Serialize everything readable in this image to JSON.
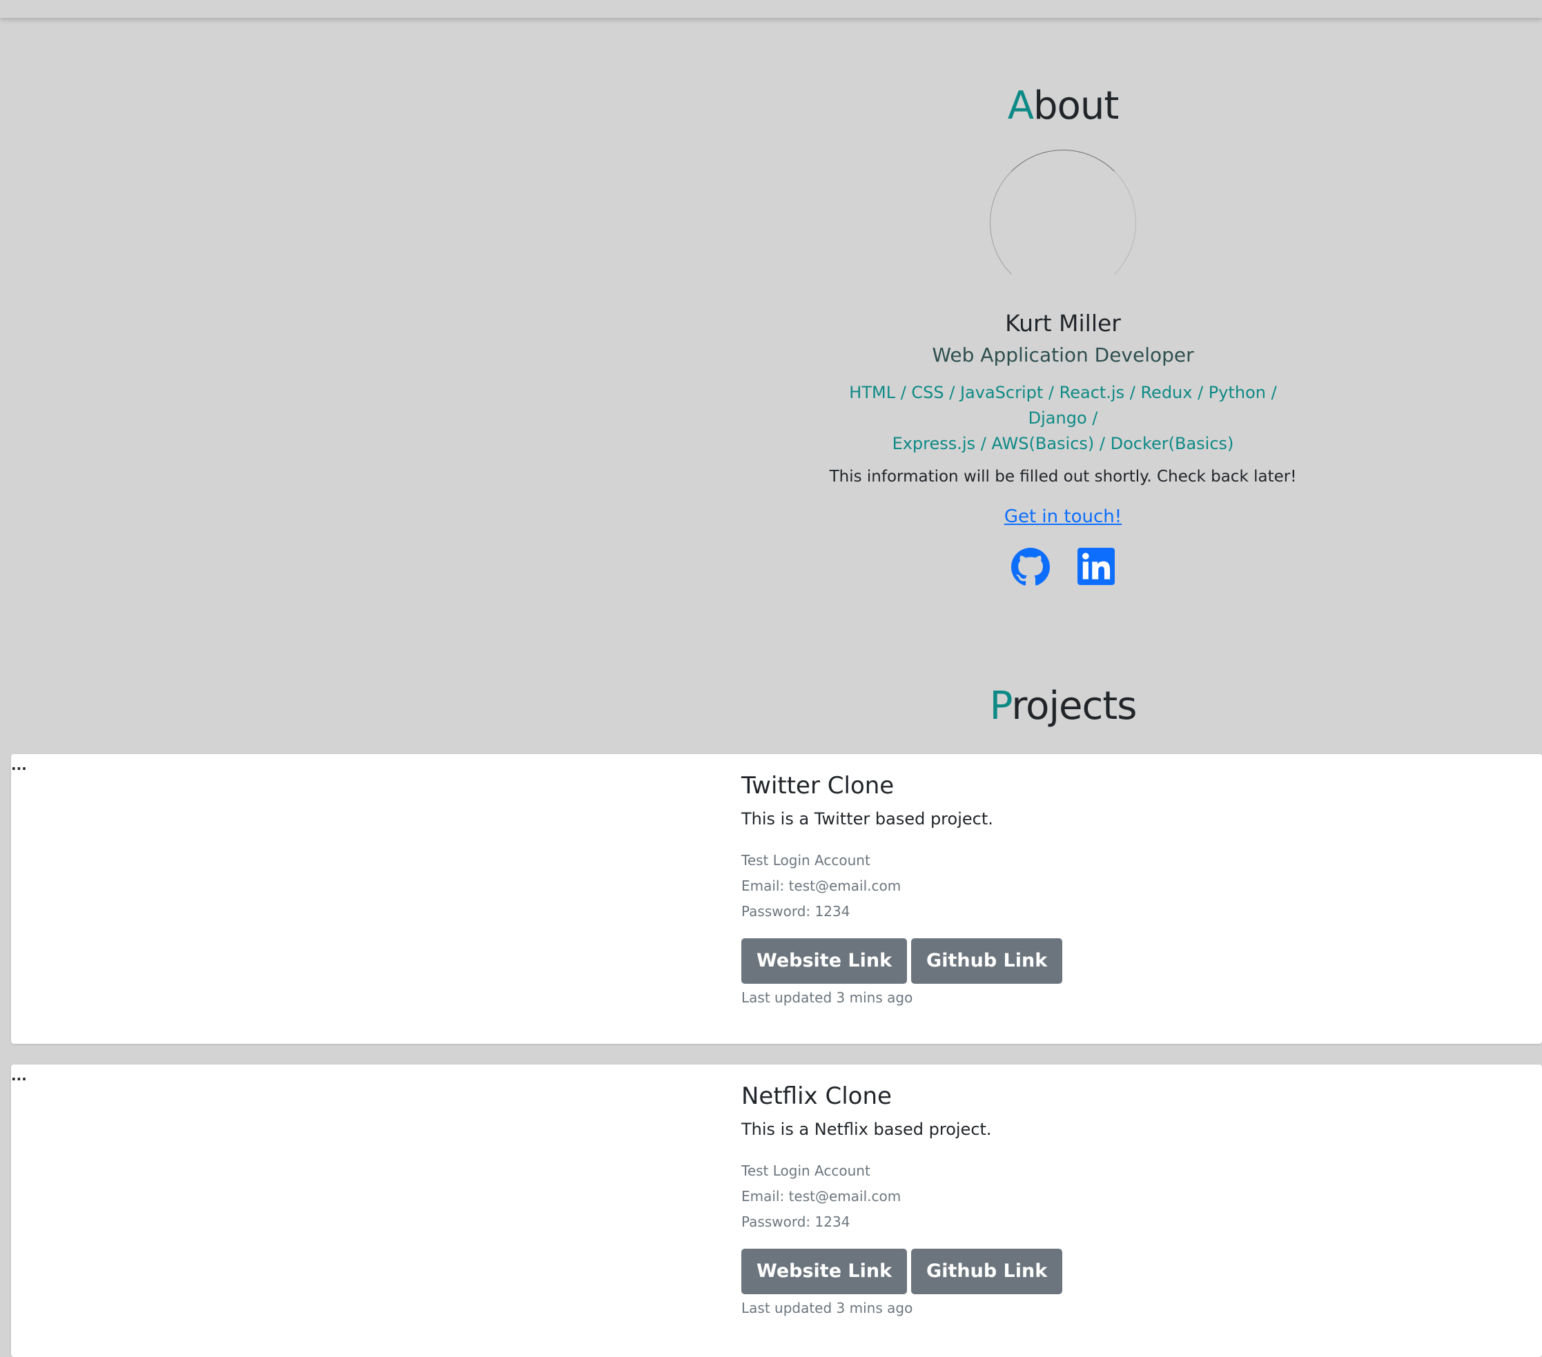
{
  "about": {
    "title_first": "A",
    "title_rest": "bout",
    "name": "Kurt Miller",
    "role": "Web Application Developer",
    "skills_line1": "HTML / CSS / JavaScript / React.js / Redux / Python / Django /",
    "skills_line2": "Express.js / AWS(Basics) / Docker(Basics)",
    "info": "This information will be filled out shortly. Check back later!",
    "contact": "Get in touch!",
    "icons": [
      "github-icon",
      "linkedin-icon"
    ],
    "accent": "#0e8a86",
    "link_color": "#0d6efd"
  },
  "projects": {
    "title_first": "P",
    "title_rest": "rojects",
    "items": [
      {
        "image_alt": "...",
        "name": "Twitter Clone",
        "desc": "This is a Twitter based project.",
        "cred_label": "Test Login Account",
        "email": "Email: test@email.com",
        "password": "Password: 1234",
        "website_btn": "Website Link",
        "github_btn": "Github Link",
        "updated": "Last updated 3 mins ago"
      },
      {
        "image_alt": "...",
        "name": "Netflix Clone",
        "desc": "This is a Netflix based project.",
        "cred_label": "Test Login Account",
        "email": "Email: test@email.com",
        "password": "Password: 1234",
        "website_btn": "Website Link",
        "github_btn": "Github Link",
        "updated": "Last updated 3 mins ago"
      }
    ]
  }
}
